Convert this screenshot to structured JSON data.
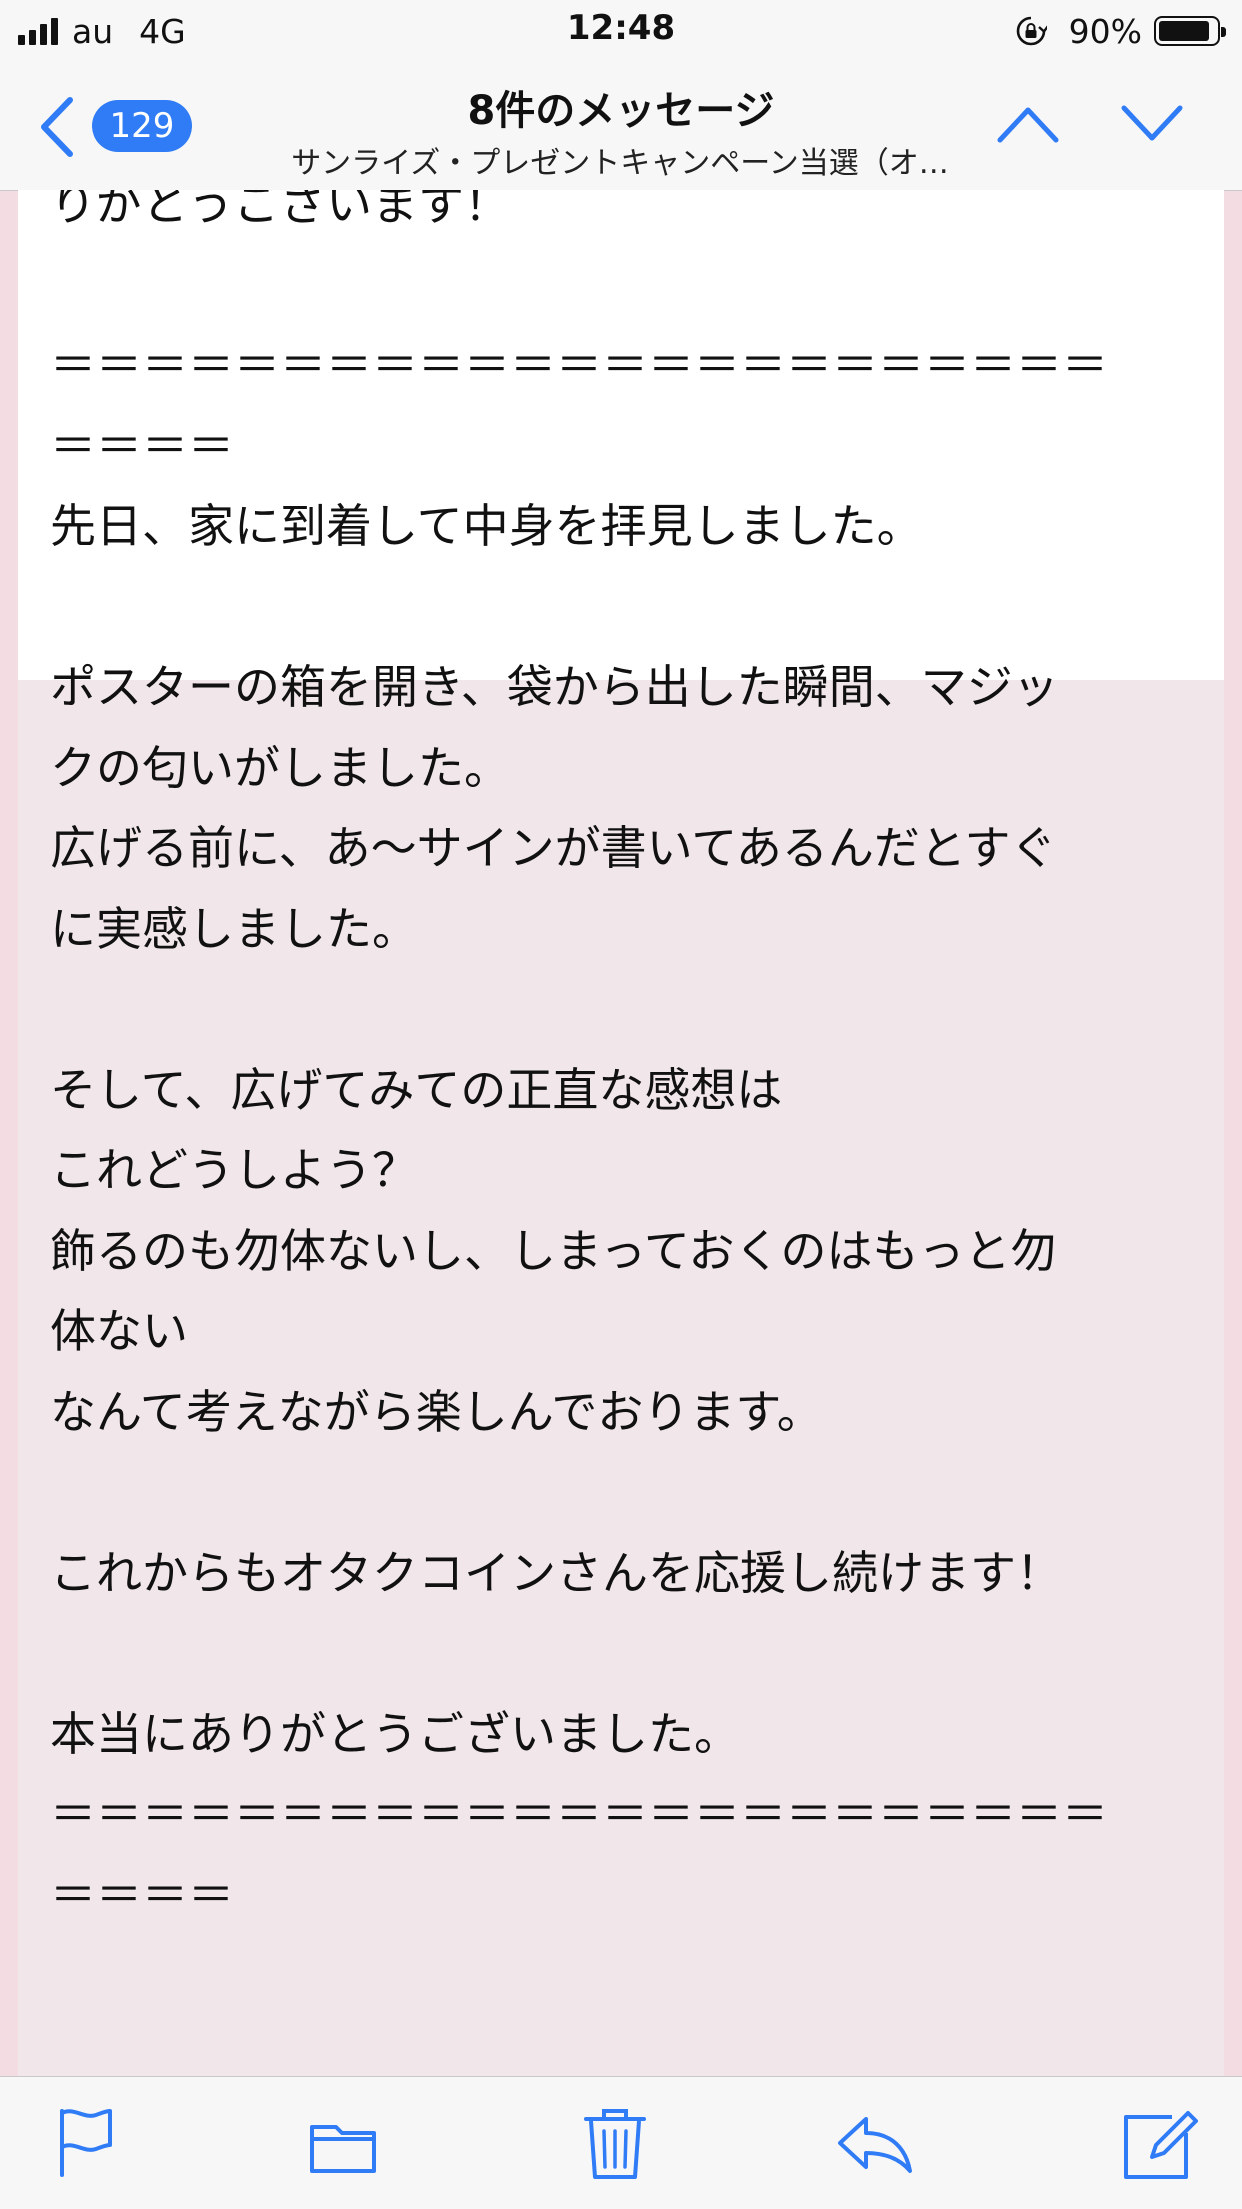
{
  "status_bar": {
    "carrier": "au",
    "network": "4G",
    "time": "12:48",
    "battery_percent": "90%",
    "battery_level": 0.9,
    "icons": [
      "signal-icon",
      "rotation-lock-icon",
      "battery-icon"
    ]
  },
  "nav": {
    "back_badge": "129",
    "title": "8件のメッセージ",
    "subtitle": "サンライズ・プレゼントキャンペーン当選（オ…",
    "icons": [
      "back-chevron-icon",
      "chevron-up-icon",
      "chevron-down-icon"
    ]
  },
  "message": {
    "body": "りがとうございます！\n\n＝＝＝＝＝＝＝＝＝＝＝＝＝＝＝＝＝＝＝＝＝＝＝\n＝＝＝＝\n先日、家に到着して中身を拝見しました。\n\nポスターの箱を開き、袋から出した瞬間、マジッ\nクの匂いがしました。\n広げる前に、あ〜サインが書いてあるんだとすぐ\nに実感しました。\n\nそして、広げてみての正直な感想は\nこれどうしよう？\n飾るのも勿体ないし、しまっておくのはもっと勿\n体ない\nなんて考えながら楽しんでおります。\n\nこれからもオタクコインさんを応援し続けます！\n\n本当にありがとうございました。\n＝＝＝＝＝＝＝＝＝＝＝＝＝＝＝＝＝＝＝＝＝＝＝\n＝＝＝＝\n\n\nオタクコイン株式"
  },
  "colors": {
    "accent": "#2f7cf6",
    "content_bg": "#f1e7ea",
    "page_bg": "#f3dde3"
  },
  "toolbar": {
    "icons": [
      "flag-icon",
      "folder-icon",
      "trash-icon",
      "reply-icon",
      "compose-icon"
    ]
  }
}
